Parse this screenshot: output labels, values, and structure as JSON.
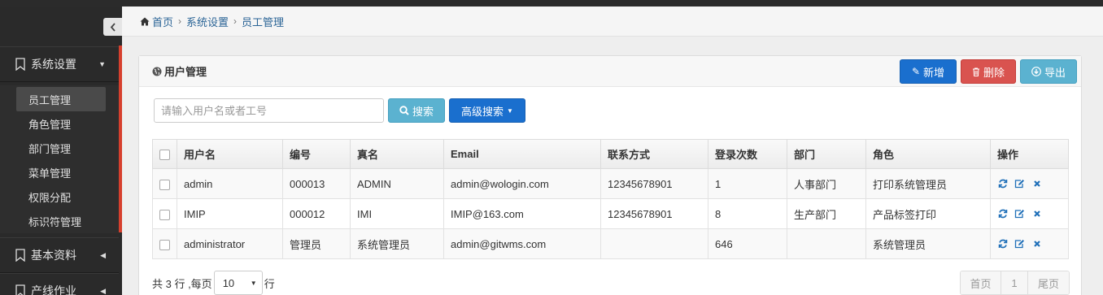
{
  "sidebar": {
    "groups": [
      {
        "label": "系统设置",
        "icon": "bookmark-icon",
        "expanded": true
      },
      {
        "label": "基本资料",
        "icon": "bookmark-icon",
        "expanded": false
      },
      {
        "label": "产线作业",
        "icon": "bookmark-icon",
        "expanded": false
      }
    ],
    "submenu": [
      {
        "label": "员工管理",
        "active": true
      },
      {
        "label": "角色管理"
      },
      {
        "label": "部门管理"
      },
      {
        "label": "菜单管理"
      },
      {
        "label": "权限分配"
      },
      {
        "label": "标识符管理"
      }
    ],
    "accent_color": "#d6402e"
  },
  "breadcrumb": [
    "首页",
    "系统设置",
    "员工管理"
  ],
  "panel": {
    "title": "用户管理",
    "add_label": "新增",
    "delete_label": "删除",
    "export_label": "导出"
  },
  "search": {
    "placeholder": "请输入用户名或者工号",
    "value": "",
    "search_label": "搜索",
    "advanced_label": "高级搜索"
  },
  "table": {
    "columns": [
      "用户名",
      "编号",
      "真名",
      "Email",
      "联系方式",
      "登录次数",
      "部门",
      "角色",
      "操作"
    ],
    "rows": [
      [
        "admin",
        "000013",
        "ADMIN",
        "admin@wologin.com",
        "12345678901",
        "1",
        "人事部门",
        "打印系统管理员"
      ],
      [
        "IMIP",
        "000012",
        "IMI",
        "IMIP@163.com",
        "12345678901",
        "8",
        "生产部门",
        "产品标签打印"
      ],
      [
        "administrator",
        "管理员",
        "系统管理员",
        "admin@gitwms.com",
        "",
        "646",
        "",
        "系统管理员"
      ]
    ]
  },
  "footer": {
    "total_text": "共 3 行 ,每页",
    "page_size": "10",
    "rows_suffix": "行"
  },
  "pager": {
    "first": "首页",
    "current": "1",
    "last": "尾页"
  },
  "colors": {
    "primary": "#1a6fce",
    "danger": "#d9534f",
    "info": "#5bb2d0"
  }
}
